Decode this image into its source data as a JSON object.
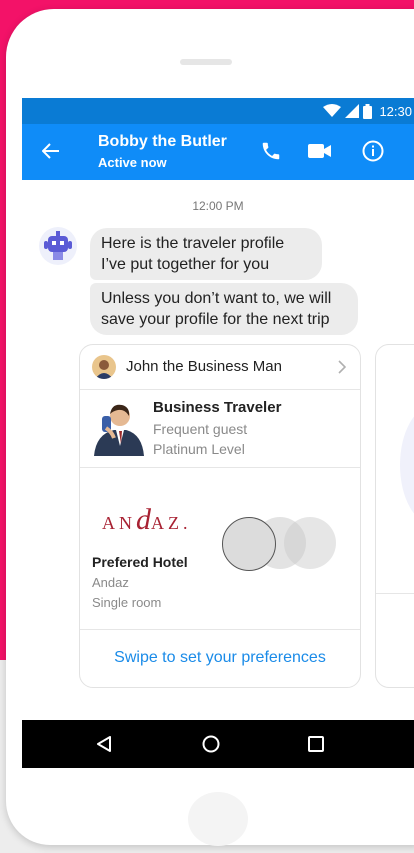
{
  "status_bar": {
    "time": "12:30"
  },
  "header": {
    "contact_name": "Bobby the Butler",
    "contact_status": "Active now"
  },
  "chat": {
    "timestamp": "12:00 PM",
    "messages": [
      "Here is the traveler profile I’ve put together for you",
      "Unless you don’t want to, we will save your profile for the next trip"
    ]
  },
  "card": {
    "header_name": "John the Business Man",
    "profile": {
      "title": "Business Traveler",
      "subtitle1": "Frequent guest",
      "subtitle2": "Platinum Level"
    },
    "hotel": {
      "logo_prefix": "AN",
      "logo_d": "d",
      "logo_suffix": "AZ.",
      "label": "Prefered Hotel",
      "name": "Andaz",
      "room": "Single room"
    },
    "cta": "Swipe to set your preferences"
  },
  "colors": {
    "status_bar": "#0a7bd4",
    "app_bar": "#0f8cf8",
    "accent_pink": "#f31268",
    "cta_blue": "#1a8be8"
  }
}
